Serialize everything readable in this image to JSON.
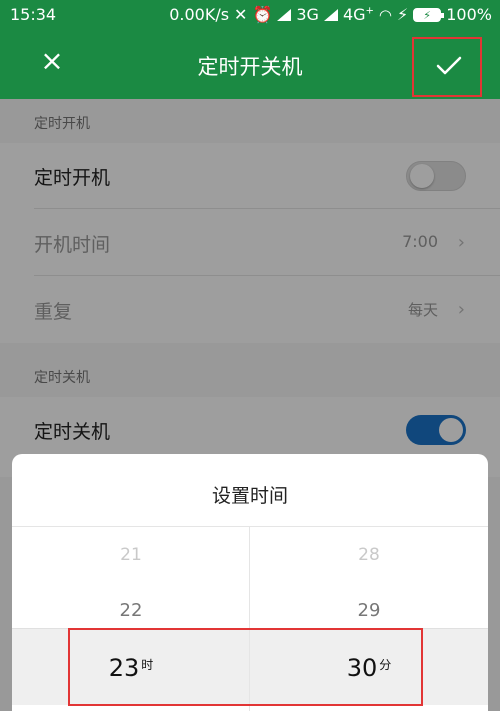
{
  "status_bar": {
    "time": "15:34",
    "network_speed": "0.00K/s",
    "network_3g": "3G",
    "network_4g": "4G",
    "network_4g_sup": "+",
    "battery": "100%"
  },
  "app_bar": {
    "title": "定时开关机",
    "close_icon": "close-icon",
    "confirm_icon": "check-icon"
  },
  "power_on": {
    "section_label": "定时开机",
    "toggle_label": "定时开机",
    "toggle_on": false,
    "time_label": "开机时间",
    "time_value": "7:00",
    "repeat_label": "重复",
    "repeat_value": "每天"
  },
  "power_off": {
    "section_label": "定时关机",
    "toggle_label": "定时关机",
    "toggle_on": true
  },
  "time_picker": {
    "title": "设置时间",
    "hours": [
      "21",
      "22",
      "23"
    ],
    "minutes": [
      "28",
      "29",
      "30"
    ],
    "hour_unit": "时",
    "minute_unit": "分"
  },
  "colors": {
    "brand_green": "#1b8a43",
    "toggle_blue": "#1a73c9",
    "highlight_red": "#e23535"
  }
}
